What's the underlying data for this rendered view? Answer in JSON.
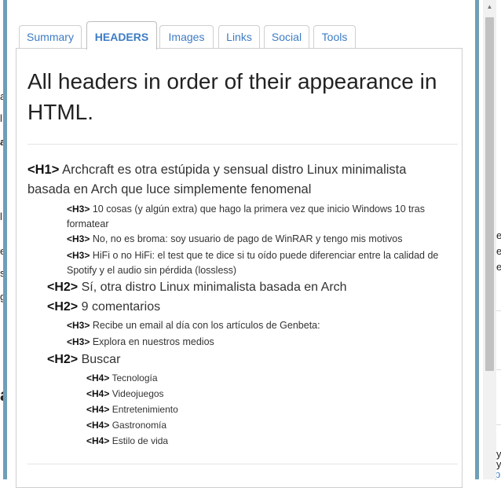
{
  "tabs": [
    {
      "label": "Summary"
    },
    {
      "label": "HEADERS"
    },
    {
      "label": "Images"
    },
    {
      "label": "Links"
    },
    {
      "label": "Social"
    },
    {
      "label": "Tools"
    }
  ],
  "title": "All headers in order of their appearance in HTML.",
  "headers": [
    {
      "tag": "<H1>",
      "text": "Archcraft es otra estúpida y sensual distro Linux minimalista basada en Arch que luce simplemente fenomenal"
    },
    {
      "tag": "<H3>",
      "text": "10 cosas (y algún extra) que hago la primera vez que inicio Windows 10 tras formatear"
    },
    {
      "tag": "<H3>",
      "text": "No, no es broma: soy usuario de pago de WinRAR y tengo mis motivos"
    },
    {
      "tag": "<H3>",
      "text": "HiFi o no HiFi: el test que te dice si tu oído puede diferenciar entre la calidad de Spotify y el audio sin pérdida (lossless)"
    },
    {
      "tag": "<H2>",
      "text": "Sí, otra distro Linux minimalista basada en Arch"
    },
    {
      "tag": "<H2>",
      "text": "9 comentarios"
    },
    {
      "tag": "<H3>",
      "text": "Recibe un email al día con los artículos de Genbeta:"
    },
    {
      "tag": "<H3>",
      "text": "Explora en nuestros medios"
    },
    {
      "tag": "<H2>",
      "text": "Buscar"
    },
    {
      "tag": "<H4>",
      "text": "Tecnología"
    },
    {
      "tag": "<H4>",
      "text": "Videojuegos"
    },
    {
      "tag": "<H4>",
      "text": "Entretenimiento"
    },
    {
      "tag": "<H4>",
      "text": "Gastronomía"
    },
    {
      "tag": "<H4>",
      "text": "Estilo de vida"
    }
  ],
  "background_fragments": {
    "left": [
      "a",
      "l",
      "a",
      "l",
      "e",
      "s",
      "g",
      "a"
    ],
    "right": [
      "e",
      "e",
      "e",
      "y",
      "y",
      "pi"
    ]
  },
  "colors": {
    "tab_text": "#3d7cc4",
    "popup_frame": "#6f9fb8"
  }
}
